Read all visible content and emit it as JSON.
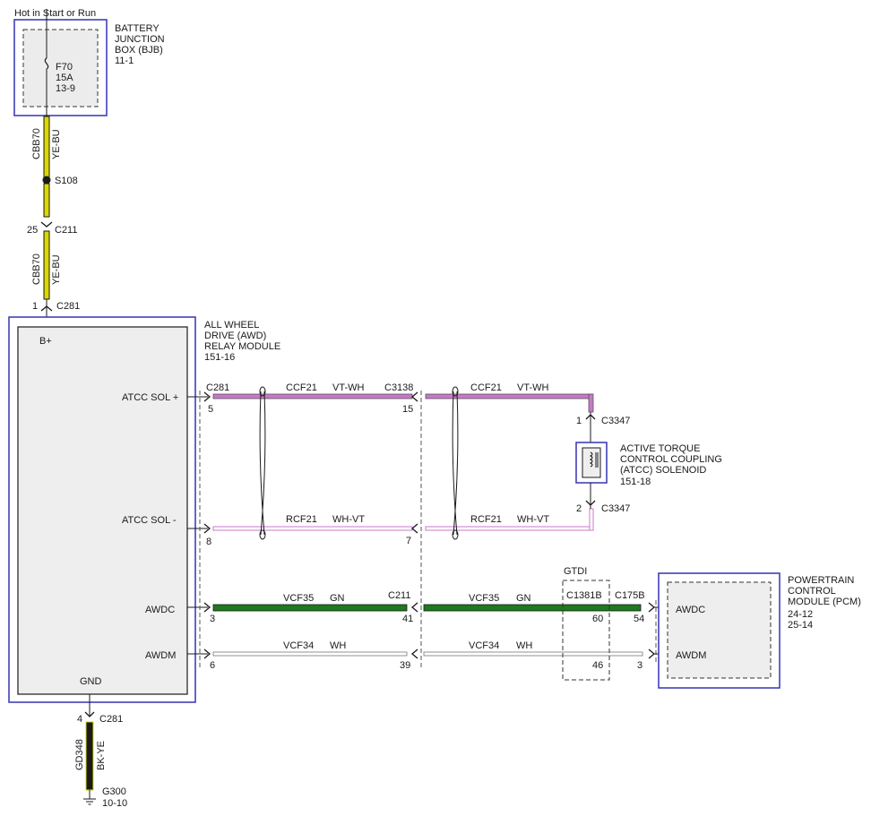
{
  "title_note": "Hot in Start or Run",
  "bjb": {
    "lines": [
      "BATTERY",
      "JUNCTION",
      "BOX (BJB)",
      "11-1"
    ]
  },
  "fuse": {
    "id": "F70",
    "rating": "15A",
    "ref": "13-9"
  },
  "wire_top": {
    "circuit": "CBB70",
    "color": "YE-BU"
  },
  "splice": {
    "id": "S108"
  },
  "c211_top": {
    "pin": "25",
    "id": "C211"
  },
  "wire_mid": {
    "circuit": "CBB70",
    "color": "YE-BU"
  },
  "c281_top": {
    "pin": "1",
    "id": "C281"
  },
  "awd": {
    "lines": [
      "ALL WHEEL",
      "DRIVE (AWD)",
      "RELAY MODULE",
      "151-16"
    ],
    "pin_bplus": "B+",
    "pin_gnd": "GND",
    "atcc_pos": "ATCC SOL +",
    "atcc_neg": "ATCC SOL -",
    "awdc": "AWDC",
    "awdm": "AWDM"
  },
  "row1": {
    "conn_left": "C281",
    "pin_left": "5",
    "circuit": "CCF21",
    "color": "VT-WH",
    "conn_mid": "C3138",
    "pin_mid": "15",
    "circuit2": "CCF21",
    "color2": "VT-WH"
  },
  "row2": {
    "pin_left": "8",
    "circuit": "RCF21",
    "color": "WH-VT",
    "pin_mid": "7",
    "circuit2": "RCF21",
    "color2": "WH-VT"
  },
  "row3": {
    "pin_left": "3",
    "circuit": "VCF35",
    "color": "GN",
    "conn_mid": "C211",
    "pin_mid": "41",
    "circuit2": "VCF35",
    "color2": "GN",
    "pin_c1381b": "60",
    "pin_pcm": "54"
  },
  "row4": {
    "pin_left": "6",
    "circuit": "VCF34",
    "color": "WH",
    "pin_mid": "39",
    "circuit2": "VCF34",
    "color2": "WH",
    "pin_c1381b": "46",
    "pin_pcm": "3"
  },
  "solenoid": {
    "pin_top": "1",
    "conn_top": "C3347",
    "pin_bot": "2",
    "conn_bot": "C3347",
    "lines": [
      "ACTIVE TORQUE",
      "CONTROL COUPLING",
      "(ATCC) SOLENOID",
      "151-18"
    ]
  },
  "gtdi": {
    "label": "GTDI",
    "conn": "C1381B"
  },
  "pcm": {
    "conn": "C175B",
    "lines": [
      "POWERTRAIN",
      "CONTROL",
      "MODULE (PCM)",
      "24-12",
      "25-14"
    ],
    "awdc": "AWDC",
    "awdm": "AWDM"
  },
  "ground": {
    "pin": "4",
    "conn": "C281",
    "circuit": "GD348",
    "color": "BK-YE",
    "id": "G300",
    "ref": "10-10"
  },
  "colors": {
    "yellow": "#d8d800",
    "violet": "#c878c8",
    "green": "#1e7a1e",
    "black": "#1a1a1a",
    "frame": "#3434b4",
    "frame_fill": "#eeeeee"
  }
}
